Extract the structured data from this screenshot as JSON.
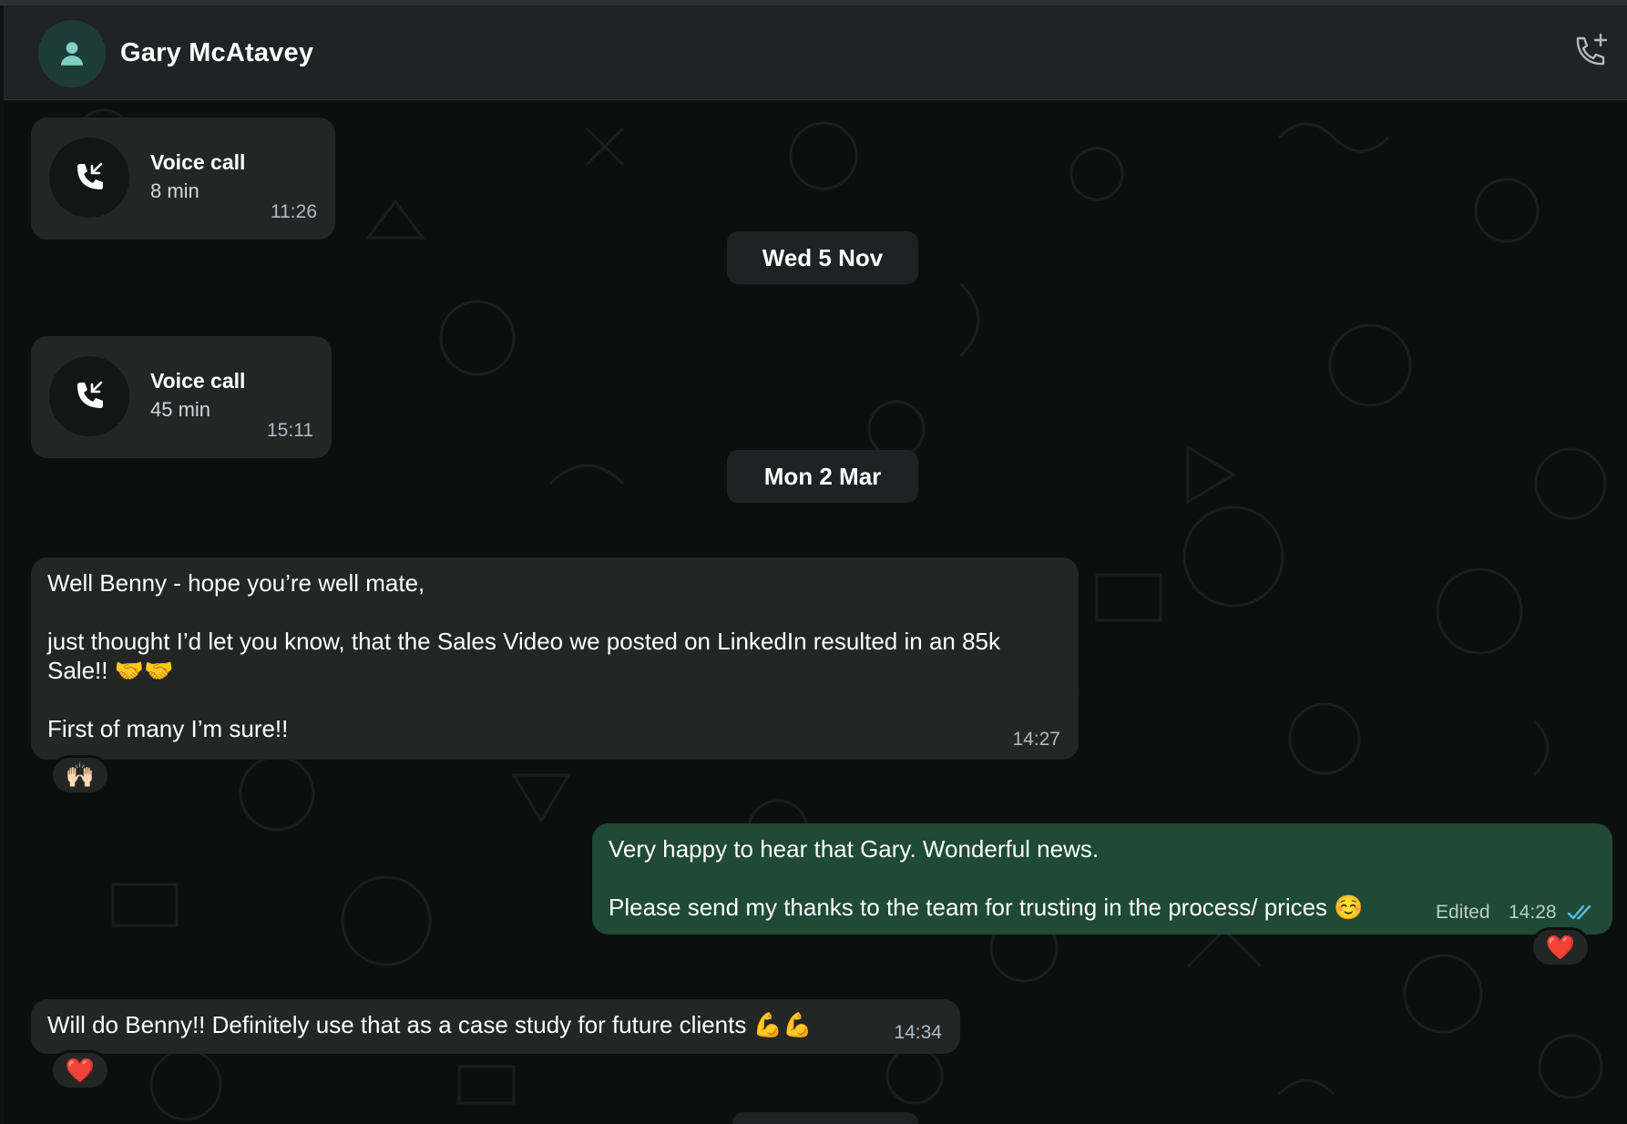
{
  "header": {
    "contact_name": "Gary McAtavey",
    "avatar_icon": "person-icon",
    "add_call_icon": "phone-plus-icon"
  },
  "calls": [
    {
      "title": "Voice call",
      "duration": "8 min",
      "time": "11:26"
    },
    {
      "title": "Voice call",
      "duration": "45 min",
      "time": "15:11"
    }
  ],
  "dates": [
    "Wed 5 Nov",
    "Mon 2 Mar"
  ],
  "messages": [
    {
      "direction": "in",
      "text": "Well Benny - hope you’re well mate,\n\njust thought I’d let you know, that the Sales Video we posted on LinkedIn resulted in an 85k\nSale!! 🤝🤝\n\nFirst of many I’m sure!!",
      "time": "14:27",
      "reaction": "🙌🏻"
    },
    {
      "direction": "out",
      "text": "Very happy to hear that Gary. Wonderful news.\n\nPlease send my thanks to the team for trusting in the process/ prices ☺️",
      "edited": "Edited",
      "time": "14:28",
      "status": "read",
      "reaction": "❤️"
    },
    {
      "direction": "in",
      "text": "Will do Benny!! Definitely use that as a case study for future clients 💪💪",
      "time": "14:34",
      "reaction": "❤️"
    }
  ],
  "colors": {
    "header_bg": "#202223",
    "chat_bg": "#0d0e0e",
    "incoming_bubble": "#242626",
    "outgoing_bubble": "#1f4a35",
    "read_ticks": "#53bdeb",
    "avatar_accent": "#7fd1c2"
  }
}
